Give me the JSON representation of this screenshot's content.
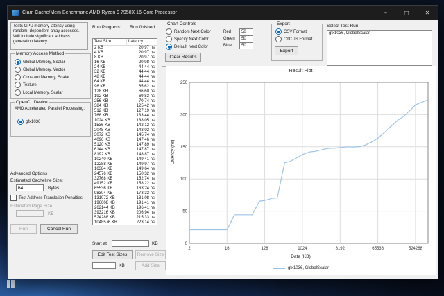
{
  "window": {
    "title": "Clam Cache/Mem Benchmark: AMD Ryzen 9 7950X 16-Core Processor",
    "controls": {
      "minimize": "–",
      "maximize": "□",
      "close": "✕"
    }
  },
  "left": {
    "description": "Tests GPU memory latency using random, dependent array accesses. Will include significant address generation latency.",
    "memory_access": {
      "title": "Memory Access Method",
      "options": [
        "Global Memory, Scalar",
        "Global Memory, Vector",
        "Constant Memory, Scalar",
        "Texture",
        "Local Memory, Scalar"
      ],
      "selected": "Global Memory, Scalar"
    },
    "device": {
      "title": "OpenCL Device",
      "platform": "AMD Accelerated Parallel Processing:",
      "options": [
        "gfx1036"
      ],
      "selected": "gfx1036"
    },
    "advanced": {
      "title": "Advanced Options",
      "cacheline_label": "Estimated Cacheline Size:",
      "cacheline_value": "64",
      "cacheline_unit": "Bytes",
      "tlb_checkbox": "Test Address Translation Penalties",
      "page_size_label": "Estimated Page Size",
      "page_size_value": "",
      "page_size_unit": "KB"
    },
    "run_button": "Run",
    "cancel_button": "Cancel Run"
  },
  "middle": {
    "progress_label": "Run Progress:",
    "progress_value": "Run finished",
    "table": {
      "headers": [
        "Test Size",
        "Latency"
      ],
      "rows": [
        [
          "2 KB",
          "20.97 ns"
        ],
        [
          "4 KB",
          "20.97 ns"
        ],
        [
          "8 KB",
          "20.97 ns"
        ],
        [
          "16 KB",
          "20.98 ns"
        ],
        [
          "24 KB",
          "44.44 ns"
        ],
        [
          "32 KB",
          "44.44 ns"
        ],
        [
          "48 KB",
          "44.44 ns"
        ],
        [
          "64 KB",
          "44.44 ns"
        ],
        [
          "96 KB",
          "65.62 ns"
        ],
        [
          "128 KB",
          "66.60 ns"
        ],
        [
          "192 KB",
          "69.83 ns"
        ],
        [
          "256 KB",
          "70.74 ns"
        ],
        [
          "384 KB",
          "125.42 ns"
        ],
        [
          "512 KB",
          "127.19 ns"
        ],
        [
          "768 KB",
          "133.44 ns"
        ],
        [
          "1024 KB",
          "138.05 ns"
        ],
        [
          "1536 KB",
          "142.12 ns"
        ],
        [
          "2048 KB",
          "143.02 ns"
        ],
        [
          "3072 KB",
          "145.74 ns"
        ],
        [
          "4096 KB",
          "147.46 ns"
        ],
        [
          "5120 KB",
          "147.89 ns"
        ],
        [
          "6144 KB",
          "147.87 ns"
        ],
        [
          "8192 KB",
          "148.87 ns"
        ],
        [
          "10240 KB",
          "149.41 ns"
        ],
        [
          "12288 KB",
          "149.97 ns"
        ],
        [
          "16384 KB",
          "149.64 ns"
        ],
        [
          "24576 KB",
          "150.32 ns"
        ],
        [
          "32768 KB",
          "152.74 ns"
        ],
        [
          "49152 KB",
          "158.22 ns"
        ],
        [
          "65536 KB",
          "163.24 ns"
        ],
        [
          "98304 KB",
          "173.32 ns"
        ],
        [
          "131072 KB",
          "181.08 ns"
        ],
        [
          "196608 KB",
          "191.41 ns"
        ],
        [
          "262144 KB",
          "196.41 ns"
        ],
        [
          "393216 KB",
          "206.94 ns"
        ],
        [
          "524288 KB",
          "215.33 ns"
        ],
        [
          "1048576 KB",
          "223.14 ns"
        ]
      ]
    },
    "start_at_label": "Start at",
    "start_at_value": "",
    "start_at_unit": "KB",
    "edit_sizes_button": "Edit Test Sizes",
    "remove_size_button": "Remove Size",
    "add_value": "",
    "add_unit": "KB",
    "add_button": "Add Size"
  },
  "chart_controls": {
    "title": "Chart Controls",
    "options": [
      "Random Next Color",
      "Specify Next Color",
      "Default Next Color"
    ],
    "selected": "Default Next Color",
    "colors": [
      {
        "label": "Red",
        "value": "50"
      },
      {
        "label": "Green",
        "value": "50"
      },
      {
        "label": "Blue",
        "value": "50"
      }
    ],
    "clear_button": "Clear Results"
  },
  "export_box": {
    "title": "Export",
    "options": [
      "CSV Format",
      "CnC JS Format"
    ],
    "selected": "CSV Format",
    "export_button": "Export"
  },
  "select_run": {
    "label": "Select Test Run:",
    "items": [
      "gfx1036, GlobalScalar"
    ]
  },
  "chart_data": {
    "type": "line",
    "title": "Result Plot",
    "xlabel": "Data (KB)",
    "ylabel": "Latency (ns)",
    "xscale": "log",
    "xlim": [
      2,
      1048576
    ],
    "ylim": [
      0,
      250
    ],
    "yticks": [
      0,
      50,
      100,
      150,
      200,
      250
    ],
    "xticks": [
      2,
      16,
      128,
      1024,
      8192,
      65536,
      524288
    ],
    "grid": true,
    "legend_position": "bottom",
    "x": [
      2,
      4,
      8,
      16,
      24,
      32,
      48,
      64,
      96,
      128,
      192,
      256,
      384,
      512,
      768,
      1024,
      1536,
      2048,
      3072,
      4096,
      5120,
      6144,
      8192,
      10240,
      12288,
      16384,
      24576,
      32768,
      49152,
      65536,
      98304,
      131072,
      196608,
      262144,
      393216,
      524288,
      1048576
    ],
    "series": [
      {
        "name": "gfx1036, GlobalScalar",
        "color": "#9dc3e6",
        "values": [
          20.97,
          20.97,
          20.97,
          20.98,
          44.44,
          44.44,
          44.44,
          44.44,
          65.62,
          66.6,
          69.83,
          70.74,
          125.42,
          127.19,
          133.44,
          138.05,
          142.12,
          143.02,
          145.74,
          147.46,
          147.89,
          147.87,
          148.87,
          149.41,
          149.97,
          149.64,
          150.32,
          152.74,
          158.22,
          163.24,
          173.32,
          181.08,
          191.41,
          196.41,
          206.94,
          215.33,
          223.14
        ]
      }
    ]
  }
}
